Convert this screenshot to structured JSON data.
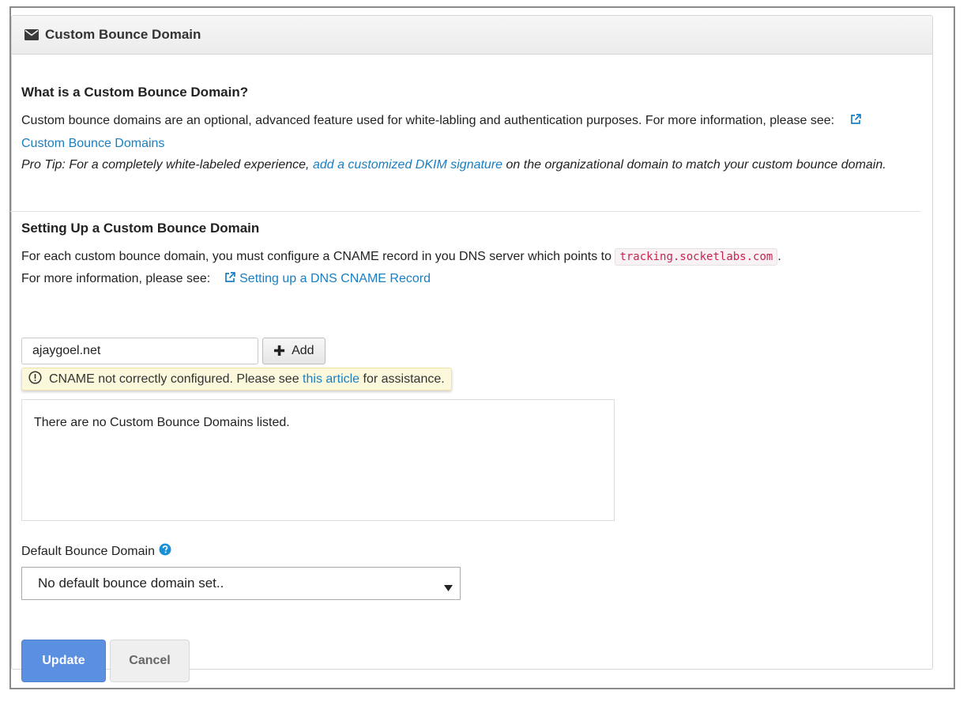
{
  "panel": {
    "title": "Custom Bounce Domain",
    "header_icon": "envelope-icon"
  },
  "intro": {
    "heading": "What is a Custom Bounce Domain?",
    "description": "Custom bounce domains are an optional, advanced feature used for white-labling and authentication purposes. For more information, please see:",
    "link_label": "Custom Bounce Domains",
    "tip_prefix": "Pro Tip: For a completely white-labeled experience,",
    "tip_link": "add a customized DKIM signature",
    "tip_suffix": "on the organizational domain to match your custom bounce domain."
  },
  "setup": {
    "heading": "Setting Up a Custom Bounce Domain",
    "instruction": "For each custom bounce domain, you must configure a CNAME record in you DNS server which points to",
    "cname_target": "tracking.socketlabs.com",
    "period": ".",
    "more_info": "For more information, please see:",
    "more_info_link": "Setting up a DNS CNAME Record"
  },
  "domain_form": {
    "input_value": "ajaygoel.net",
    "add_label": "Add"
  },
  "warning": {
    "prefix": "CNAME not correctly configured. Please see",
    "link": "this article",
    "suffix": "for assistance."
  },
  "domain_list": {
    "empty_text": "There are no Custom Bounce Domains listed."
  },
  "default_domain": {
    "label": "Default Bounce Domain",
    "selected": "No default bounce domain set.."
  },
  "actions": {
    "update": "Update",
    "cancel": "Cancel"
  },
  "colors": {
    "link": "#1a7fc1",
    "primary": "#5b8fe0",
    "warning_bg": "#fcf8dc",
    "code": "#c7254e"
  }
}
